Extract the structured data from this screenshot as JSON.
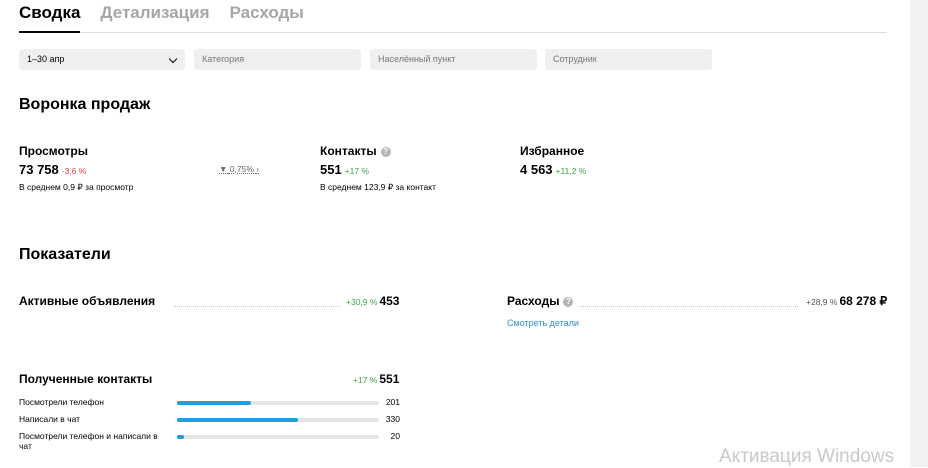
{
  "tabs": [
    "Сводка",
    "Детализация",
    "Расходы"
  ],
  "filters": {
    "date": "1–30 апр",
    "category": "Категория",
    "city": "Населённый пункт",
    "employee": "Сотрудник"
  },
  "funnel": {
    "title": "Воронка продаж",
    "views": {
      "label": "Просмотры",
      "value": "73 758",
      "delta": "-3,6 %",
      "note": "В среднем 0,9 ₽ за просмотр"
    },
    "conversion": "0,75%",
    "contacts": {
      "label": "Контакты",
      "value": "551",
      "delta": "+17 %",
      "note": "В среднем 123,9 ₽ за контакт"
    },
    "favorites": {
      "label": "Избранное",
      "value": "4 563",
      "delta": "+11,2 %"
    }
  },
  "indicators": {
    "title": "Показатели",
    "active_ads": {
      "label": "Активные объявления",
      "delta": "+30,9 %",
      "value": "453"
    },
    "expenses": {
      "label": "Расходы",
      "delta": "+28,9 %",
      "value": "68 278 ₽",
      "link": "Смотреть детали"
    },
    "contacts_received": {
      "label": "Полученные контакты",
      "delta": "+17 %",
      "value": "551",
      "rows": [
        {
          "label": "Посмотрели телефон",
          "value": "201",
          "fraction": 0.365
        },
        {
          "label": "Написали в чат",
          "value": "330",
          "fraction": 0.6
        },
        {
          "label": "Посмотрели телефон и написали в чат",
          "value": "20",
          "fraction": 0.036
        }
      ]
    }
  },
  "watermark": "Активация Windows",
  "colors": {
    "accent_bar": "#1e9fe3",
    "positive": "#3ca64b",
    "negative": "#e0404a",
    "link": "#2b8ed6"
  }
}
